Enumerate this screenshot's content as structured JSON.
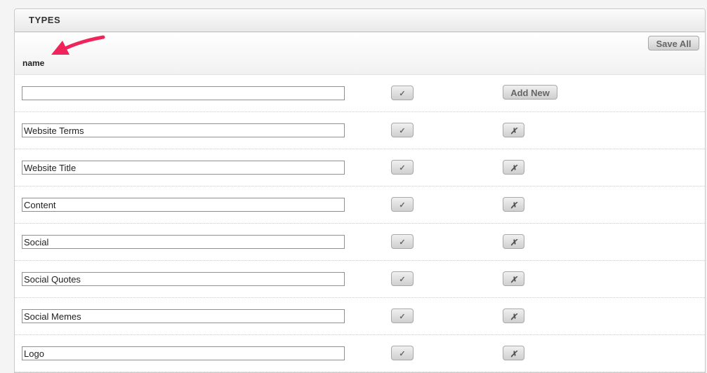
{
  "panel": {
    "title": "TYPES",
    "column_header": "name",
    "save_all_label": "Save All",
    "annotation_color": "#f0245a"
  },
  "new_row": {
    "value": "",
    "check_glyph": "✓",
    "add_new_label": "Add New"
  },
  "rows": [
    {
      "value": "Website Terms",
      "check_glyph": "✓",
      "delete_glyph": "✗"
    },
    {
      "value": "Website Title",
      "check_glyph": "✓",
      "delete_glyph": "✗"
    },
    {
      "value": "Content",
      "check_glyph": "✓",
      "delete_glyph": "✗"
    },
    {
      "value": "Social",
      "check_glyph": "✓",
      "delete_glyph": "✗"
    },
    {
      "value": "Social Quotes",
      "check_glyph": "✓",
      "delete_glyph": "✗"
    },
    {
      "value": "Social Memes",
      "check_glyph": "✓",
      "delete_glyph": "✗"
    },
    {
      "value": "Logo",
      "check_glyph": "✓",
      "delete_glyph": "✗"
    }
  ]
}
